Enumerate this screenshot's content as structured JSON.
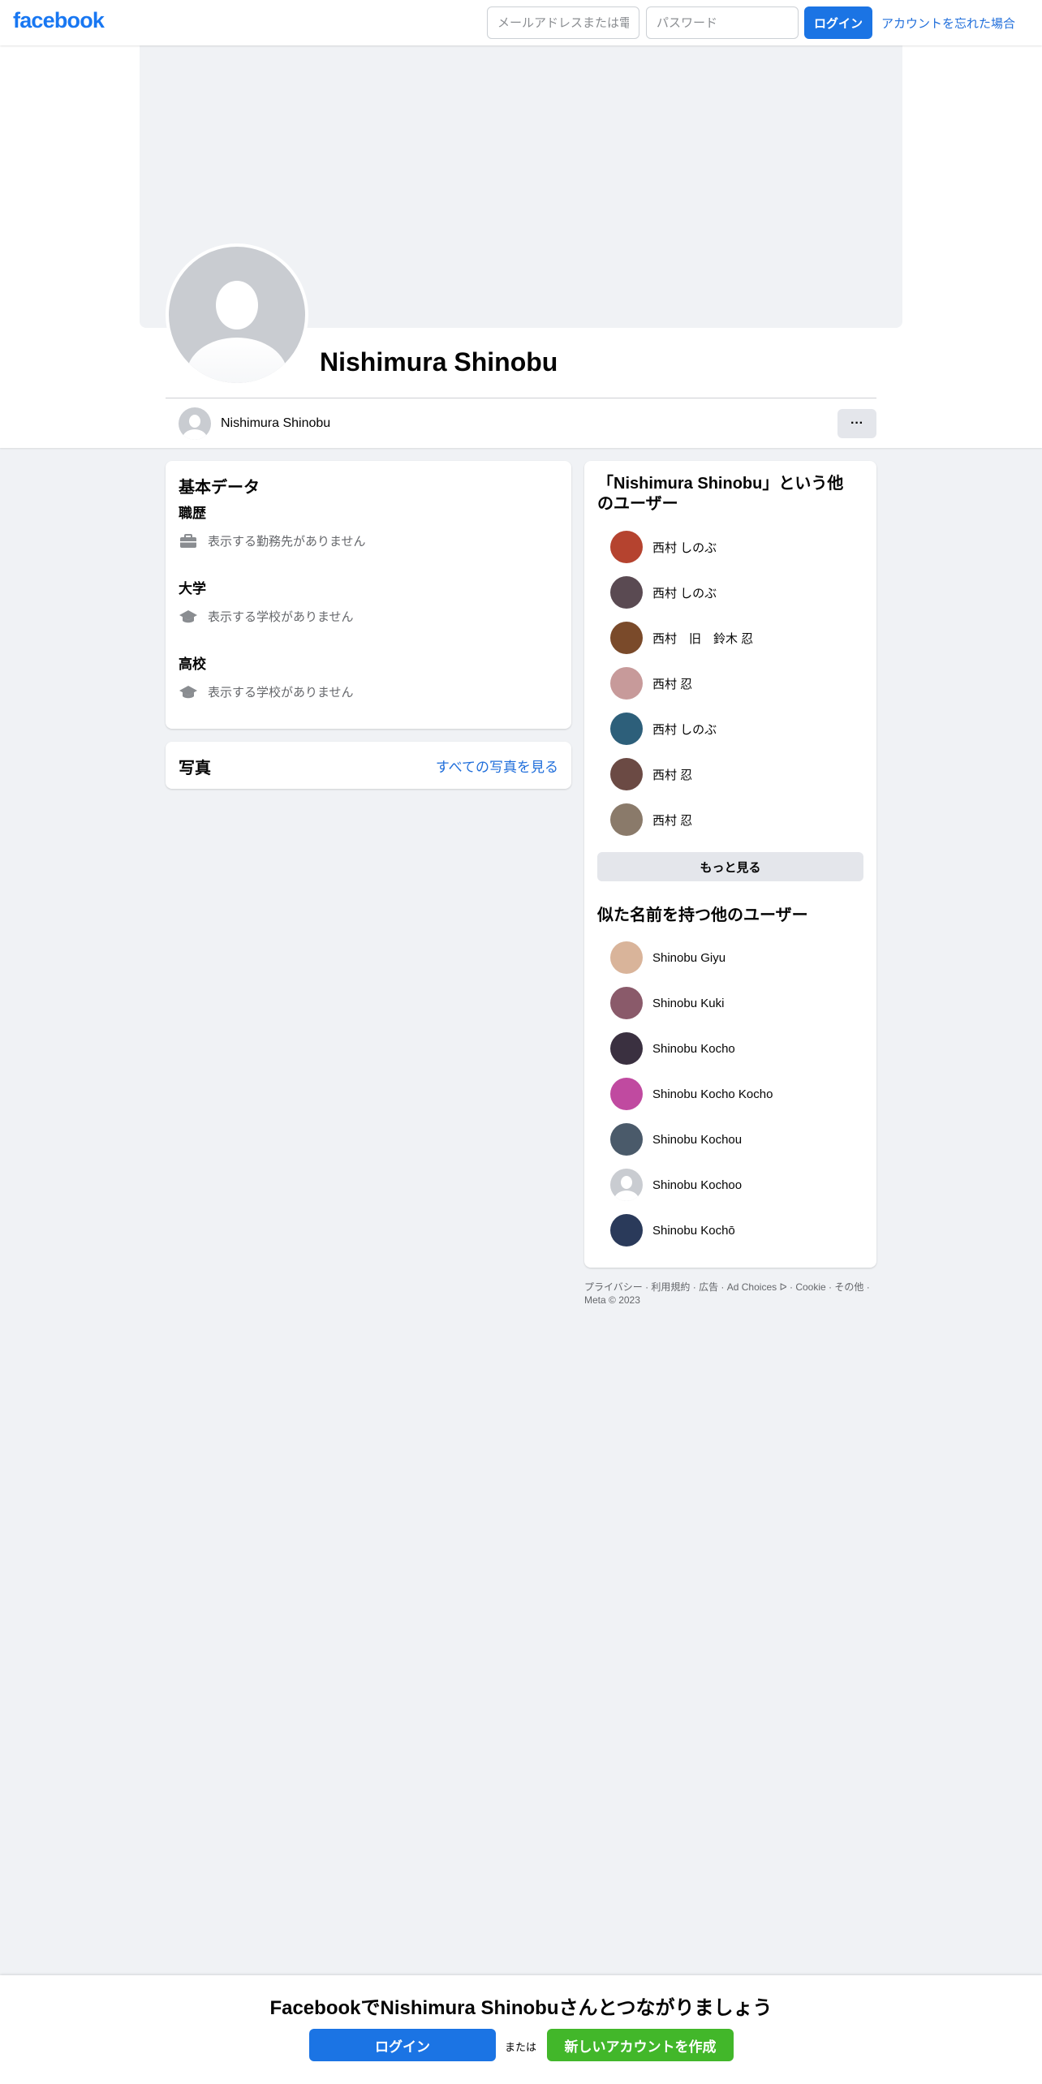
{
  "topbar": {
    "logo": "facebook",
    "email_placeholder": "メールアドレスまたは電話番号",
    "password_placeholder": "パスワード",
    "login_label": "ログイン",
    "forgot_label": "アカウントを忘れた場合"
  },
  "profile": {
    "name": "Nishimura Shinobu",
    "more_label": "···"
  },
  "intro": {
    "title": "基本データ",
    "sections": [
      {
        "title": "職歴",
        "text": "表示する勤務先がありません",
        "icon": "briefcase-icon"
      },
      {
        "title": "大学",
        "text": "表示する学校がありません",
        "icon": "graduation-cap-icon"
      },
      {
        "title": "高校",
        "text": "表示する学校がありません",
        "icon": "graduation-cap-icon"
      }
    ]
  },
  "photos": {
    "title": "写真",
    "see_all": "すべての写真を見る"
  },
  "same_name": {
    "title": "「Nishimura Shinobu」という他のユーザー",
    "people": [
      {
        "name": "西村 しのぶ",
        "color": "#b5432f"
      },
      {
        "name": "西村 しのぶ",
        "color": "#5a4a52"
      },
      {
        "name": "西村　旧　鈴木 忍",
        "color": "#7a4a2a"
      },
      {
        "name": "西村 忍",
        "color": "#c79a9a"
      },
      {
        "name": "西村 しのぶ",
        "color": "#2d5f7a"
      },
      {
        "name": "西村 忍",
        "color": "#6b4a44"
      },
      {
        "name": "西村 忍",
        "color": "#8a7a6a"
      }
    ],
    "see_more": "もっと見る"
  },
  "similar_name": {
    "title": "似た名前を持つ他のユーザー",
    "people": [
      {
        "name": "Shinobu Giyu",
        "color": "#d9b49a"
      },
      {
        "name": "Shinobu Kuki",
        "color": "#8a5a6a"
      },
      {
        "name": "Shinobu Kocho",
        "color": "#3a3040"
      },
      {
        "name": "Shinobu Kocho Kocho",
        "color": "#c04aa0"
      },
      {
        "name": "Shinobu Kochou",
        "color": "#4a5a6a"
      },
      {
        "name": "Shinobu Kochoo",
        "color": "#c9ccd1"
      },
      {
        "name": "Shinobu Kochō",
        "color": "#2a3a5a"
      }
    ]
  },
  "footer": {
    "text": "プライバシー · 利用規約 · 広告 · Ad Choices ᐅ · Cookie · その他 · Meta © 2023"
  },
  "banner": {
    "title": "FacebookでNishimura Shinobuさんとつながりましょう",
    "login_label": "ログイン",
    "or_label": "または",
    "create_label": "新しいアカウントを作成"
  }
}
